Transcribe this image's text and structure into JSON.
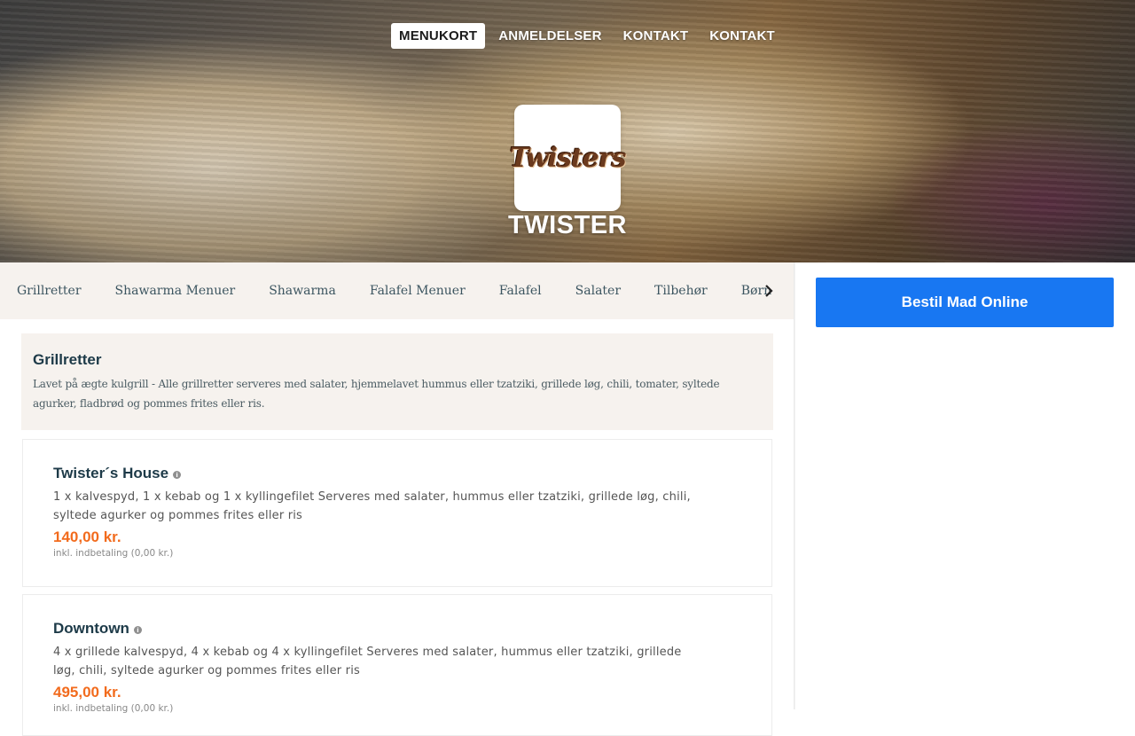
{
  "nav": {
    "items": [
      {
        "label": "MENUKORT",
        "active": true
      },
      {
        "label": "ANMELDELSER",
        "active": false
      },
      {
        "label": "KONTAKT",
        "active": false
      },
      {
        "label": "KONTAKT",
        "active": false
      }
    ]
  },
  "hero": {
    "logo_text": "Twisters",
    "restaurant_name": "TWISTER"
  },
  "categories": [
    "Grillretter",
    "Shawarma Menuer",
    "Shawarma",
    "Falafel Menuer",
    "Falafel",
    "Salater",
    "Tilbehør",
    "Børn"
  ],
  "section": {
    "title": "Grillretter",
    "description": "Lavet på ægte kulgrill - Alle grillretter serveres med salater, hjemmelavet hummus eller tzatziki, grillede løg, chili, tomater, syltede agurker, fladbrød og pommes frites eller ris."
  },
  "items": [
    {
      "name": "Twister´s House",
      "description": "1 x kalvespyd, 1 x kebab og 1 x kyllingefilet Serveres med salater, hummus eller tzatziki, grillede løg, chili, syltede agurker og pommes frites eller ris",
      "price": "140,00 kr.",
      "deposit": "inkl. indbetaling (0,00 kr.)"
    },
    {
      "name": "Downtown",
      "description": "4 x grillede kalvespyd, 4 x kebab og 4 x kyllingefilet Serveres med salater, hummus eller tzatziki, grillede løg, chili, syltede agurker og pommes frites eller ris",
      "price": "495,00 kr.",
      "deposit": "inkl. indbetaling (0,00 kr.)"
    }
  ],
  "order": {
    "button_label": "Bestil Mad Online"
  },
  "icons": {
    "info": "info-icon",
    "scroll_right": "chevron-right-icon"
  },
  "colors": {
    "accent_blue": "#1877f2",
    "price_orange": "#f26b1d",
    "heading_navy": "#1d3a48",
    "panel_beige": "#f6f2ee"
  }
}
